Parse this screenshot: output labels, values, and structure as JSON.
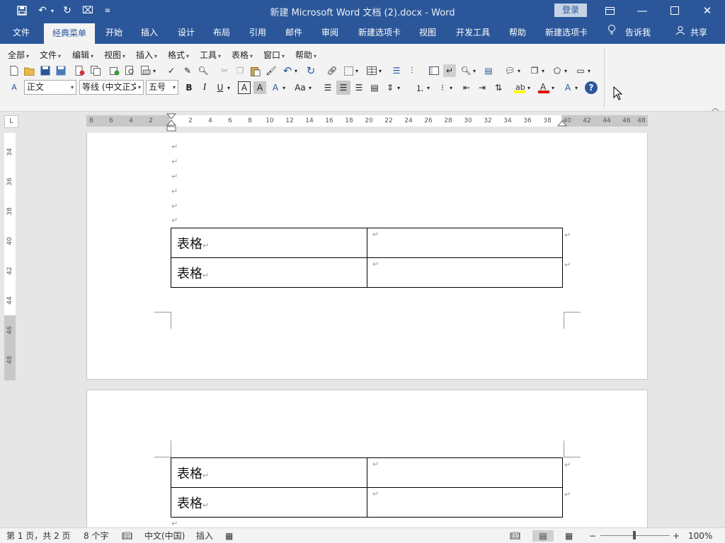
{
  "window": {
    "title": "新建 Microsoft Word 文档 (2).docx  -  Word",
    "login_label": "登录"
  },
  "tabs": [
    {
      "label": "文件"
    },
    {
      "label": "经典菜单",
      "active": true
    },
    {
      "label": "开始"
    },
    {
      "label": "插入"
    },
    {
      "label": "设计"
    },
    {
      "label": "布局"
    },
    {
      "label": "引用"
    },
    {
      "label": "邮件"
    },
    {
      "label": "审阅"
    },
    {
      "label": "新建选项卡"
    },
    {
      "label": "视图"
    },
    {
      "label": "开发工具"
    },
    {
      "label": "帮助"
    },
    {
      "label": "新建选项卡"
    }
  ],
  "tell_me": "告诉我",
  "share": "共享",
  "classic_menu": [
    "全部",
    "文件",
    "编辑",
    "视图",
    "插入",
    "格式",
    "工具",
    "表格",
    "窗口",
    "帮助"
  ],
  "format_bar": {
    "style": "正文",
    "font": "等线 (中文正文)",
    "size": "五号",
    "bold": "B",
    "italic": "I",
    "underline": "U",
    "char_border": "A",
    "char_shade": "A",
    "change_case": "Aa"
  },
  "ruler": {
    "h_ticks_left": [
      "8",
      "6",
      "4",
      "2"
    ],
    "h_ticks_right": [
      "2",
      "4",
      "6",
      "8",
      "10",
      "12",
      "14",
      "16",
      "18",
      "20",
      "22",
      "24",
      "26",
      "28",
      "30",
      "32",
      "34",
      "36",
      "38",
      "40",
      "42",
      "44",
      "46",
      "48"
    ],
    "v_ticks": [
      "34",
      "36",
      "38",
      "40",
      "42",
      "44",
      "46",
      "48"
    ],
    "corner": "L"
  },
  "document": {
    "paragraph_mark": "↵",
    "table_top": {
      "cells": [
        "表格",
        "表格"
      ]
    },
    "table_bottom": {
      "cells": [
        "表格",
        "表格"
      ]
    }
  },
  "status": {
    "page": "第 1 页，共 2 页",
    "words": "8 个字",
    "language": "中文(中国)",
    "mode": "插入",
    "zoom": "100%",
    "zoom_minus": "−",
    "zoom_plus": "+"
  },
  "colors": {
    "brand": "#2b579a",
    "highlight": "#ffff00",
    "font_color": "#e00000"
  }
}
